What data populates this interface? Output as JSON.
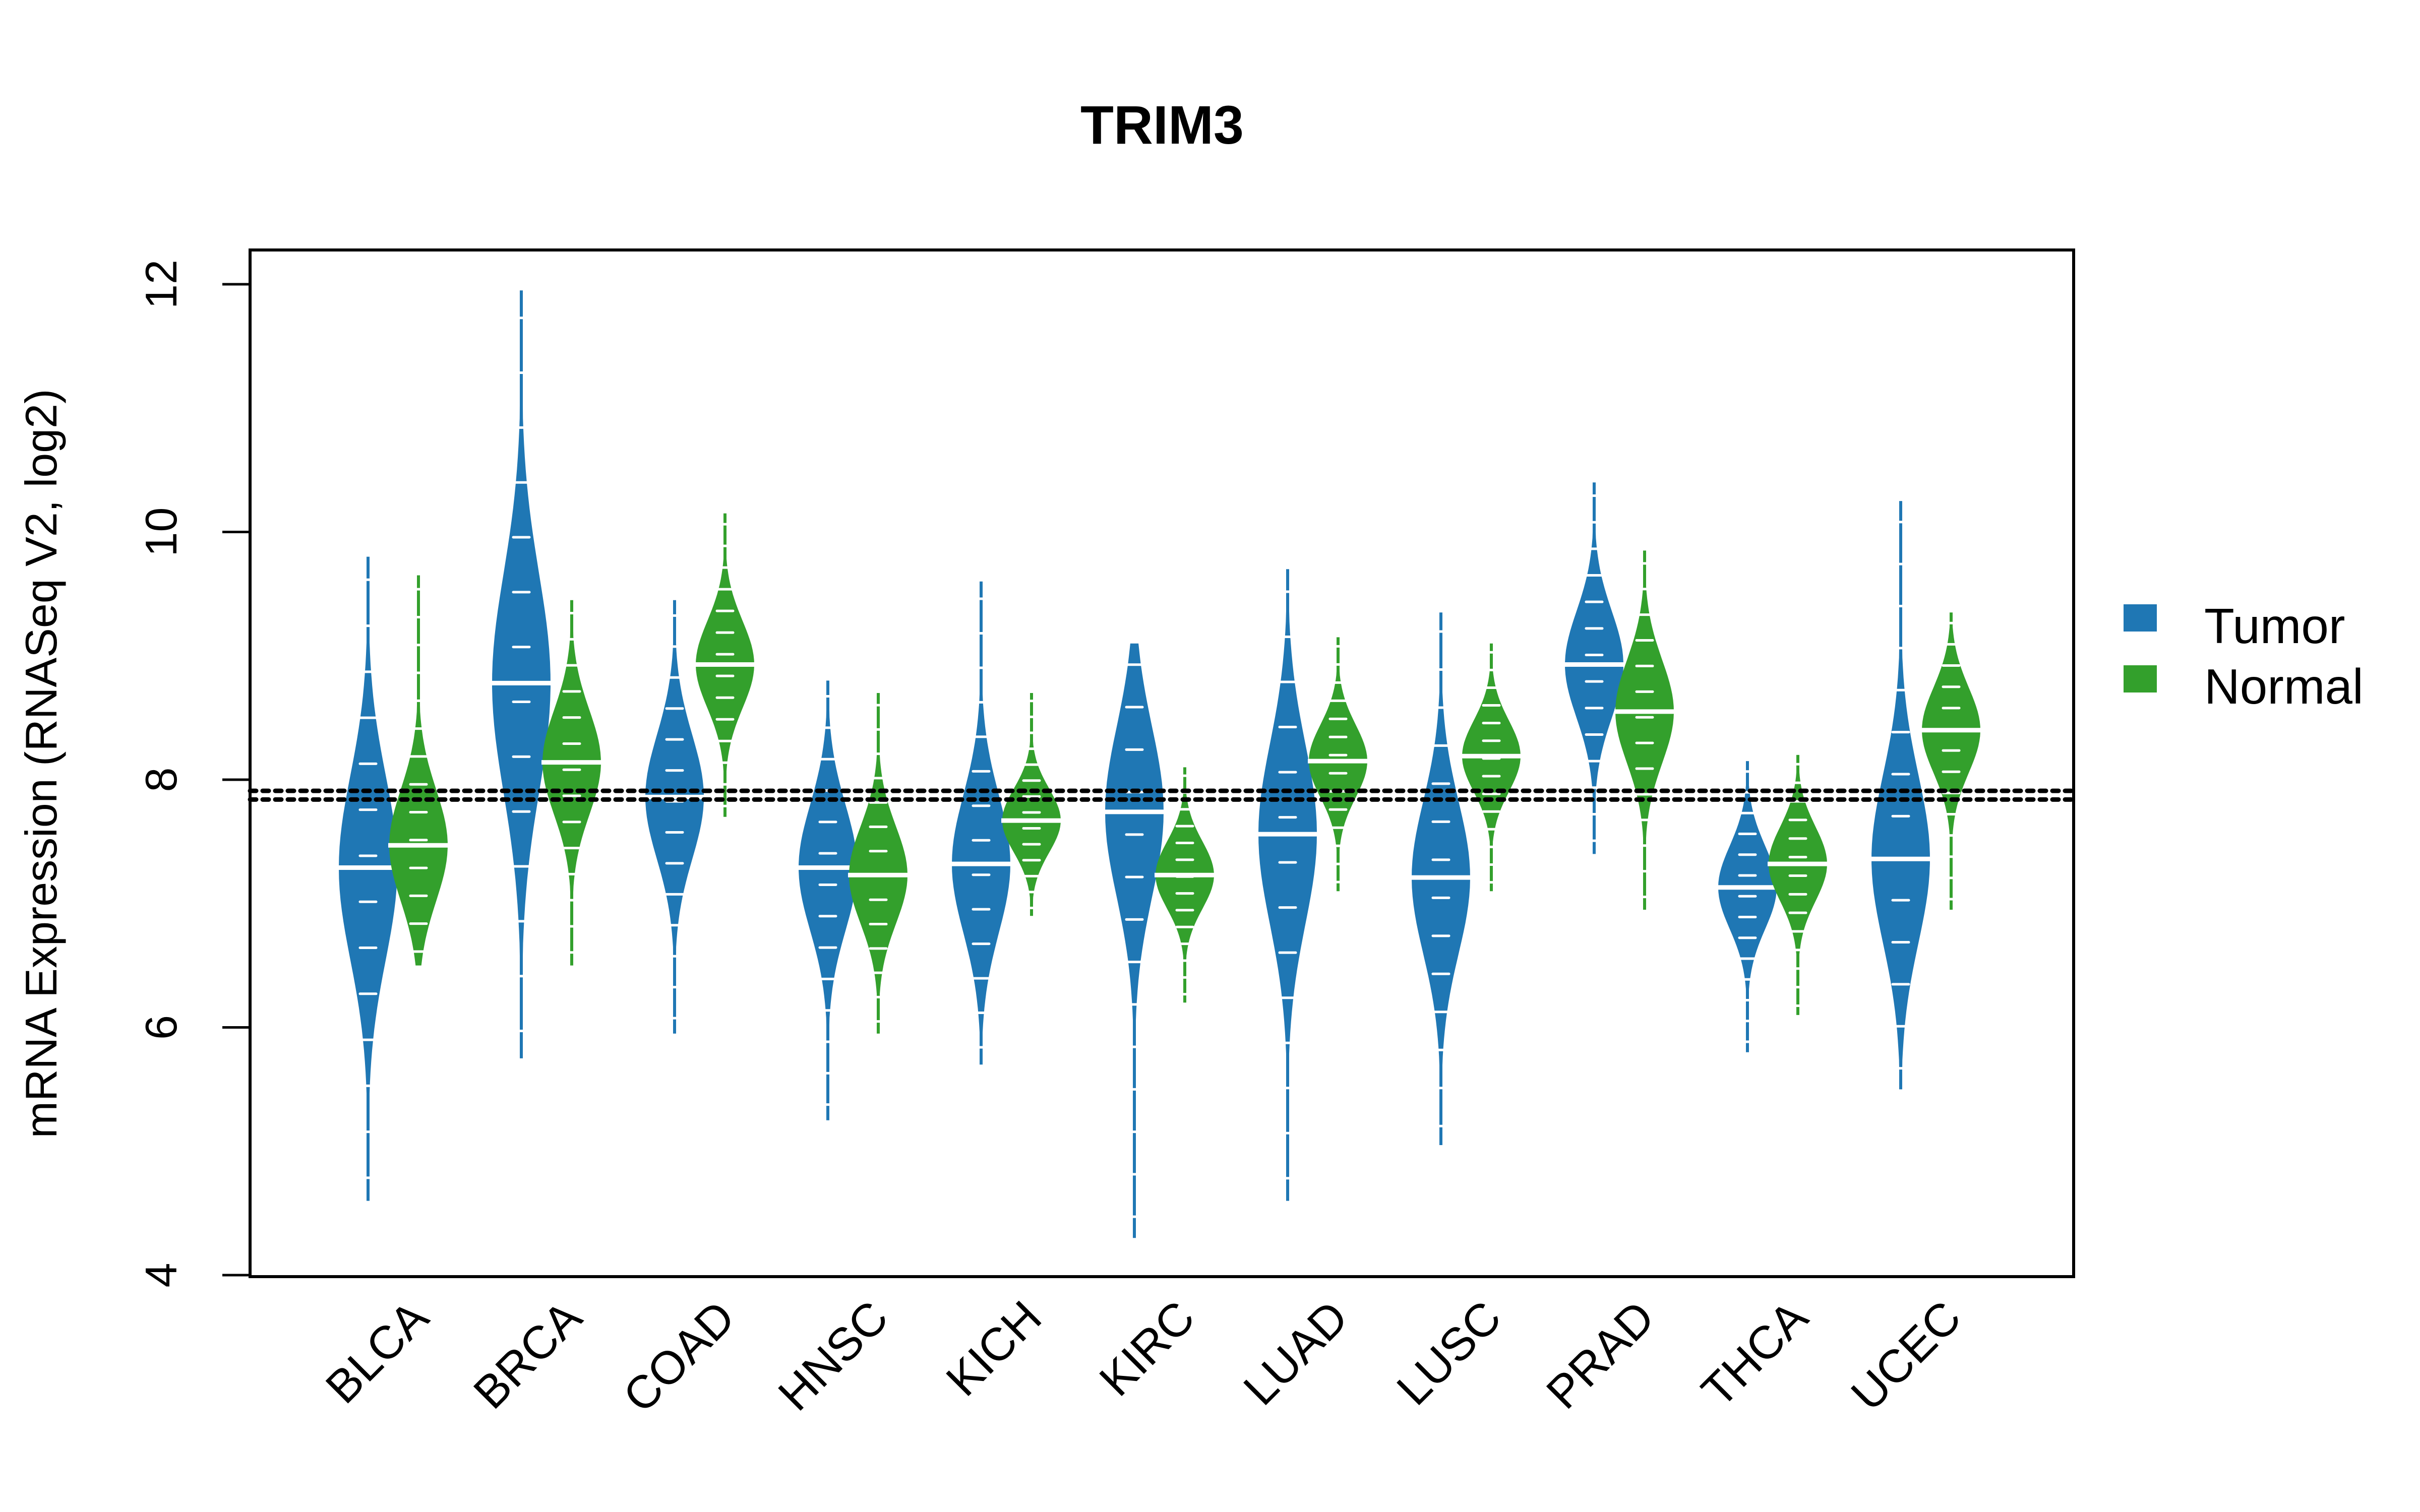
{
  "chart_data": {
    "type": "beanplot",
    "title": "TRIM3",
    "xlabel": "",
    "ylabel": "mRNA Expression (RNASeq V2, log2)",
    "ylim": [
      4,
      12.3
    ],
    "yticks": [
      4,
      6,
      8,
      10,
      12
    ],
    "grid": false,
    "categories": [
      "BLCA",
      "BRCA",
      "COAD",
      "HNSC",
      "KICH",
      "KIRC",
      "LUAD",
      "LUSC",
      "PRAD",
      "THCA",
      "UCEC"
    ],
    "reference_lines": [
      7.91,
      7.84
    ],
    "legend": {
      "placement": "right",
      "entries": [
        {
          "name": "Tumor",
          "color": "#1F77B4"
        },
        {
          "name": "Normal",
          "color": "#33A02C"
        }
      ]
    },
    "series": [
      {
        "name": "Tumor",
        "color": "#1F77B4",
        "median": [
          7.29,
          8.78,
          7.86,
          7.29,
          7.32,
          7.74,
          7.56,
          7.21,
          8.93,
          7.13,
          7.36
        ],
        "min": [
          4.6,
          5.75,
          5.95,
          5.25,
          5.7,
          4.3,
          4.6,
          5.05,
          7.4,
          5.8,
          5.5
        ],
        "max": [
          9.8,
          11.95,
          9.45,
          8.8,
          9.6,
          9.1,
          9.7,
          9.35,
          10.4,
          8.15,
          10.25
        ]
      },
      {
        "name": "Normal",
        "color": "#33A02C",
        "median": [
          7.47,
          8.14,
          8.93,
          7.23,
          7.67,
          7.23,
          8.15,
          8.19,
          8.55,
          7.32,
          8.4
        ],
        "min": [
          6.5,
          6.5,
          7.7,
          5.95,
          6.9,
          6.2,
          7.1,
          7.1,
          6.95,
          6.1,
          6.95
        ],
        "max": [
          9.65,
          9.45,
          10.15,
          8.7,
          8.7,
          8.1,
          9.15,
          9.1,
          9.85,
          8.2,
          9.35
        ]
      }
    ]
  }
}
